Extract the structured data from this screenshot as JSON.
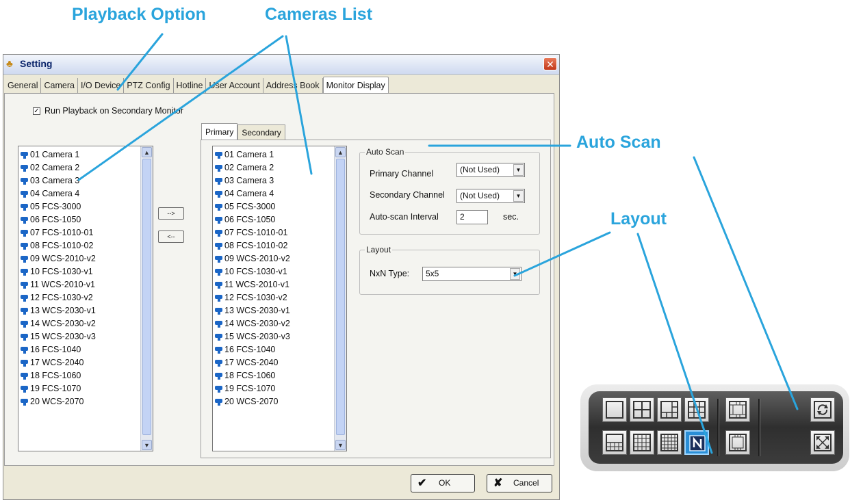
{
  "annotations": {
    "playback_option": "Playback Option",
    "cameras_list": "Cameras List",
    "auto_scan": "Auto Scan",
    "layout": "Layout"
  },
  "window": {
    "title": "Setting",
    "close_label": "✕"
  },
  "tabs": [
    "General",
    "Camera",
    "I/O Device",
    "PTZ Config",
    "Hotline",
    "User Account",
    "Address Book",
    "Monitor Display"
  ],
  "active_tab": "Monitor Display",
  "run_playback": {
    "label": "Run Playback on Secondary Monitor",
    "checked": true,
    "mark": "✓"
  },
  "cameras": [
    "01 Camera 1",
    "02 Camera 2",
    "03 Camera 3",
    "04 Camera 4",
    "05 FCS-3000",
    "06 FCS-1050",
    "07 FCS-1010-01",
    "08 FCS-1010-02",
    "09 WCS-2010-v2",
    "10 FCS-1030-v1",
    "11 WCS-2010-v1",
    "12 FCS-1030-v2",
    "13 WCS-2030-v1",
    "14 WCS-2030-v2",
    "15 WCS-2030-v3",
    "16 FCS-1040",
    "17 WCS-2040",
    "18 FCS-1060",
    "19 FCS-1070",
    "20 WCS-2070"
  ],
  "move_buttons": {
    "add": "-->",
    "remove": "<--"
  },
  "monitor_tabs": {
    "primary": "Primary",
    "secondary": "Secondary"
  },
  "auto_scan": {
    "legend": "Auto Scan",
    "primary_label": "Primary Channel",
    "primary_value": "(Not Used)",
    "secondary_label": "Secondary Channel",
    "secondary_value": "(Not Used)",
    "interval_label": "Auto-scan Interval",
    "interval_value": "2",
    "interval_unit": "sec."
  },
  "layout": {
    "legend": "Layout",
    "nxn_label": "NxN Type:",
    "nxn_value": "5x5"
  },
  "buttons": {
    "ok": "OK",
    "cancel": "Cancel"
  },
  "colors": {
    "annotation": "#2aa4dc",
    "selected_layout": "#2a8ed6"
  },
  "icons": {
    "scroll_up": "▲",
    "scroll_down": "▼",
    "combo": "▼",
    "ok": "✔",
    "cancel": "✘",
    "window": "♣"
  }
}
